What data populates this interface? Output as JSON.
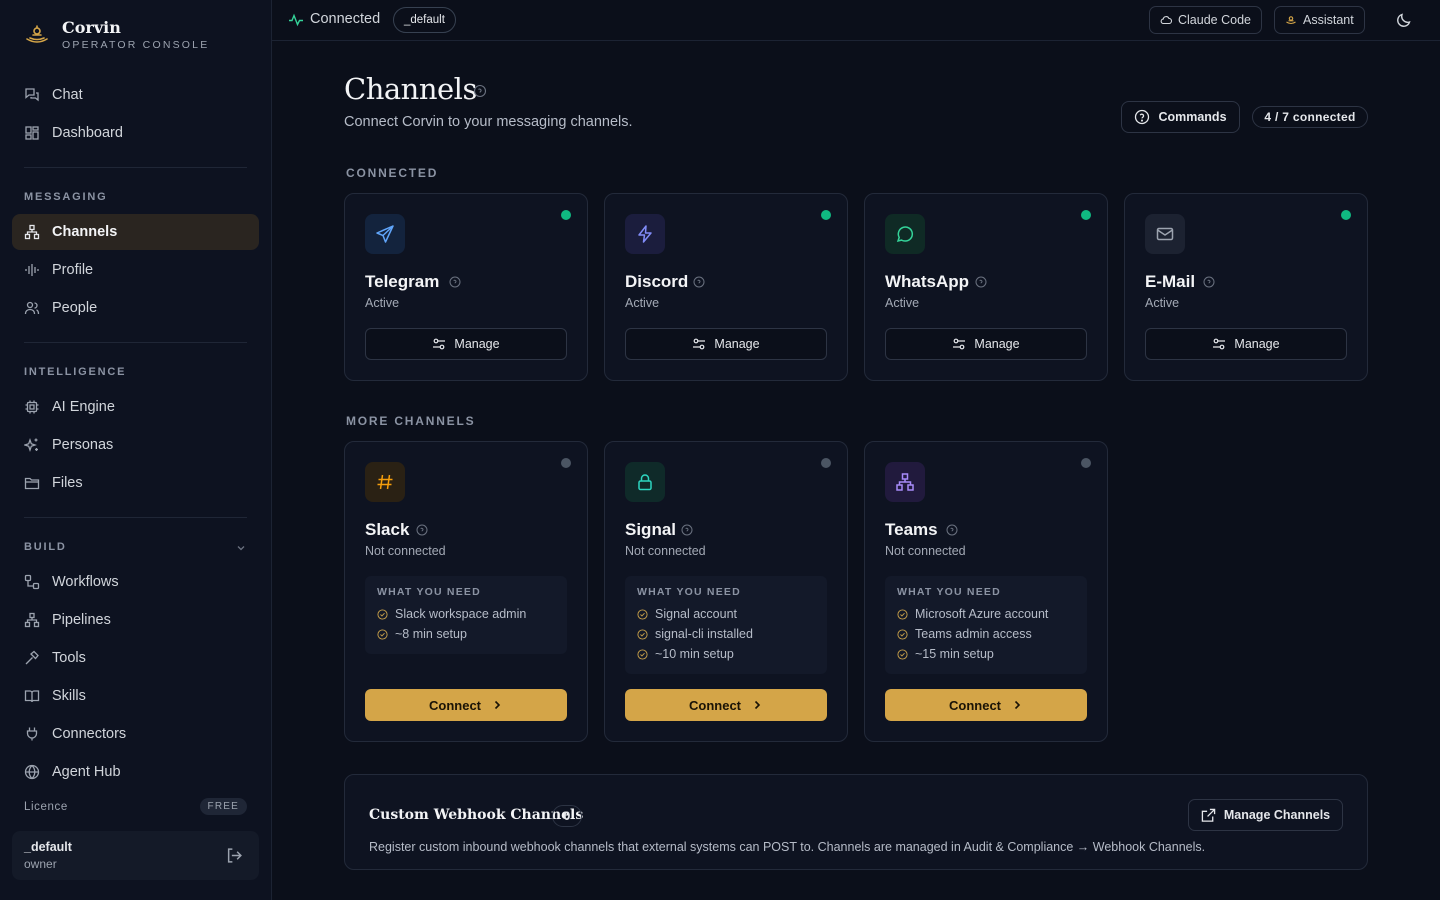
{
  "app": {
    "name": "Corvin",
    "subtitle": "OPERATOR CONSOLE"
  },
  "sidebar": {
    "top_items": [
      {
        "label": "Chat",
        "icon": "chat-icon"
      },
      {
        "label": "Dashboard",
        "icon": "dashboard-icon"
      }
    ],
    "messaging": {
      "label": "MESSAGING",
      "items": [
        {
          "label": "Channels",
          "icon": "channels-icon",
          "active": true
        },
        {
          "label": "Profile",
          "icon": "profile-icon"
        },
        {
          "label": "People",
          "icon": "people-icon"
        }
      ]
    },
    "intelligence": {
      "label": "INTELLIGENCE",
      "items": [
        {
          "label": "AI Engine",
          "icon": "cpu-icon"
        },
        {
          "label": "Personas",
          "icon": "sparkles-icon"
        },
        {
          "label": "Files",
          "icon": "folder-icon"
        }
      ]
    },
    "build": {
      "label": "BUILD",
      "items": [
        {
          "label": "Workflows",
          "icon": "workflow-icon"
        },
        {
          "label": "Pipelines",
          "icon": "pipeline-icon"
        },
        {
          "label": "Tools",
          "icon": "hammer-icon"
        },
        {
          "label": "Skills",
          "icon": "book-icon"
        },
        {
          "label": "Connectors",
          "icon": "plug-icon"
        },
        {
          "label": "Agent Hub",
          "icon": "globe-icon"
        }
      ]
    },
    "licence": {
      "label": "Licence",
      "badge": "FREE"
    },
    "user": {
      "name": "_default",
      "role": "owner"
    }
  },
  "topbar": {
    "status": "Connected",
    "workspace": "_default",
    "buttons": [
      {
        "label": "Claude Code",
        "icon": "cloud-icon"
      },
      {
        "label": "Assistant",
        "icon": "assistant-icon"
      }
    ]
  },
  "page": {
    "title": "Channels",
    "subtitle": "Connect Corvin to your messaging channels.",
    "commands_label": "Commands",
    "connected_count": "4 / 7 connected"
  },
  "connected_section": {
    "label": "CONNECTED",
    "channels": [
      {
        "name": "Telegram",
        "status": "Active",
        "action": "Manage",
        "icon": "send-icon",
        "color": "#60a5fa",
        "bg": "#13233d"
      },
      {
        "name": "Discord",
        "status": "Active",
        "action": "Manage",
        "icon": "bolt-icon",
        "color": "#818cf8",
        "bg": "#1b1d3d"
      },
      {
        "name": "WhatsApp",
        "status": "Active",
        "action": "Manage",
        "icon": "message-circle-icon",
        "color": "#34d399",
        "bg": "#0f2a25"
      },
      {
        "name": "E-Mail",
        "status": "Active",
        "action": "Manage",
        "icon": "mail-icon",
        "color": "#9ca3af",
        "bg": "#1c2231"
      }
    ],
    "dot_color": "#10b981"
  },
  "more_section": {
    "label": "MORE CHANNELS",
    "needs_title": "WHAT YOU NEED",
    "action": "Connect",
    "dot_color": "#4b5563",
    "channels": [
      {
        "name": "Slack",
        "status": "Not connected",
        "icon": "hash-icon",
        "color": "#f59e0b",
        "bg": "#2a2114",
        "needs": [
          "Slack workspace admin",
          "~8 min setup"
        ]
      },
      {
        "name": "Signal",
        "status": "Not connected",
        "icon": "lock-icon",
        "color": "#2dd4bf",
        "bg": "#0f2a29",
        "needs": [
          "Signal account",
          "signal-cli installed",
          "~10 min setup"
        ]
      },
      {
        "name": "Teams",
        "status": "Not connected",
        "icon": "network-icon",
        "color": "#a78bfa",
        "bg": "#211a3d",
        "needs": [
          "Microsoft Azure account",
          "Teams admin access",
          "~15 min setup"
        ]
      }
    ]
  },
  "webhook": {
    "title": "Custom Webhook Channels",
    "count": "0",
    "button": "Manage Channels",
    "description": "Register custom inbound webhook channels that external systems can POST to. Channels are managed in Audit & Compliance → Webhook Channels."
  }
}
